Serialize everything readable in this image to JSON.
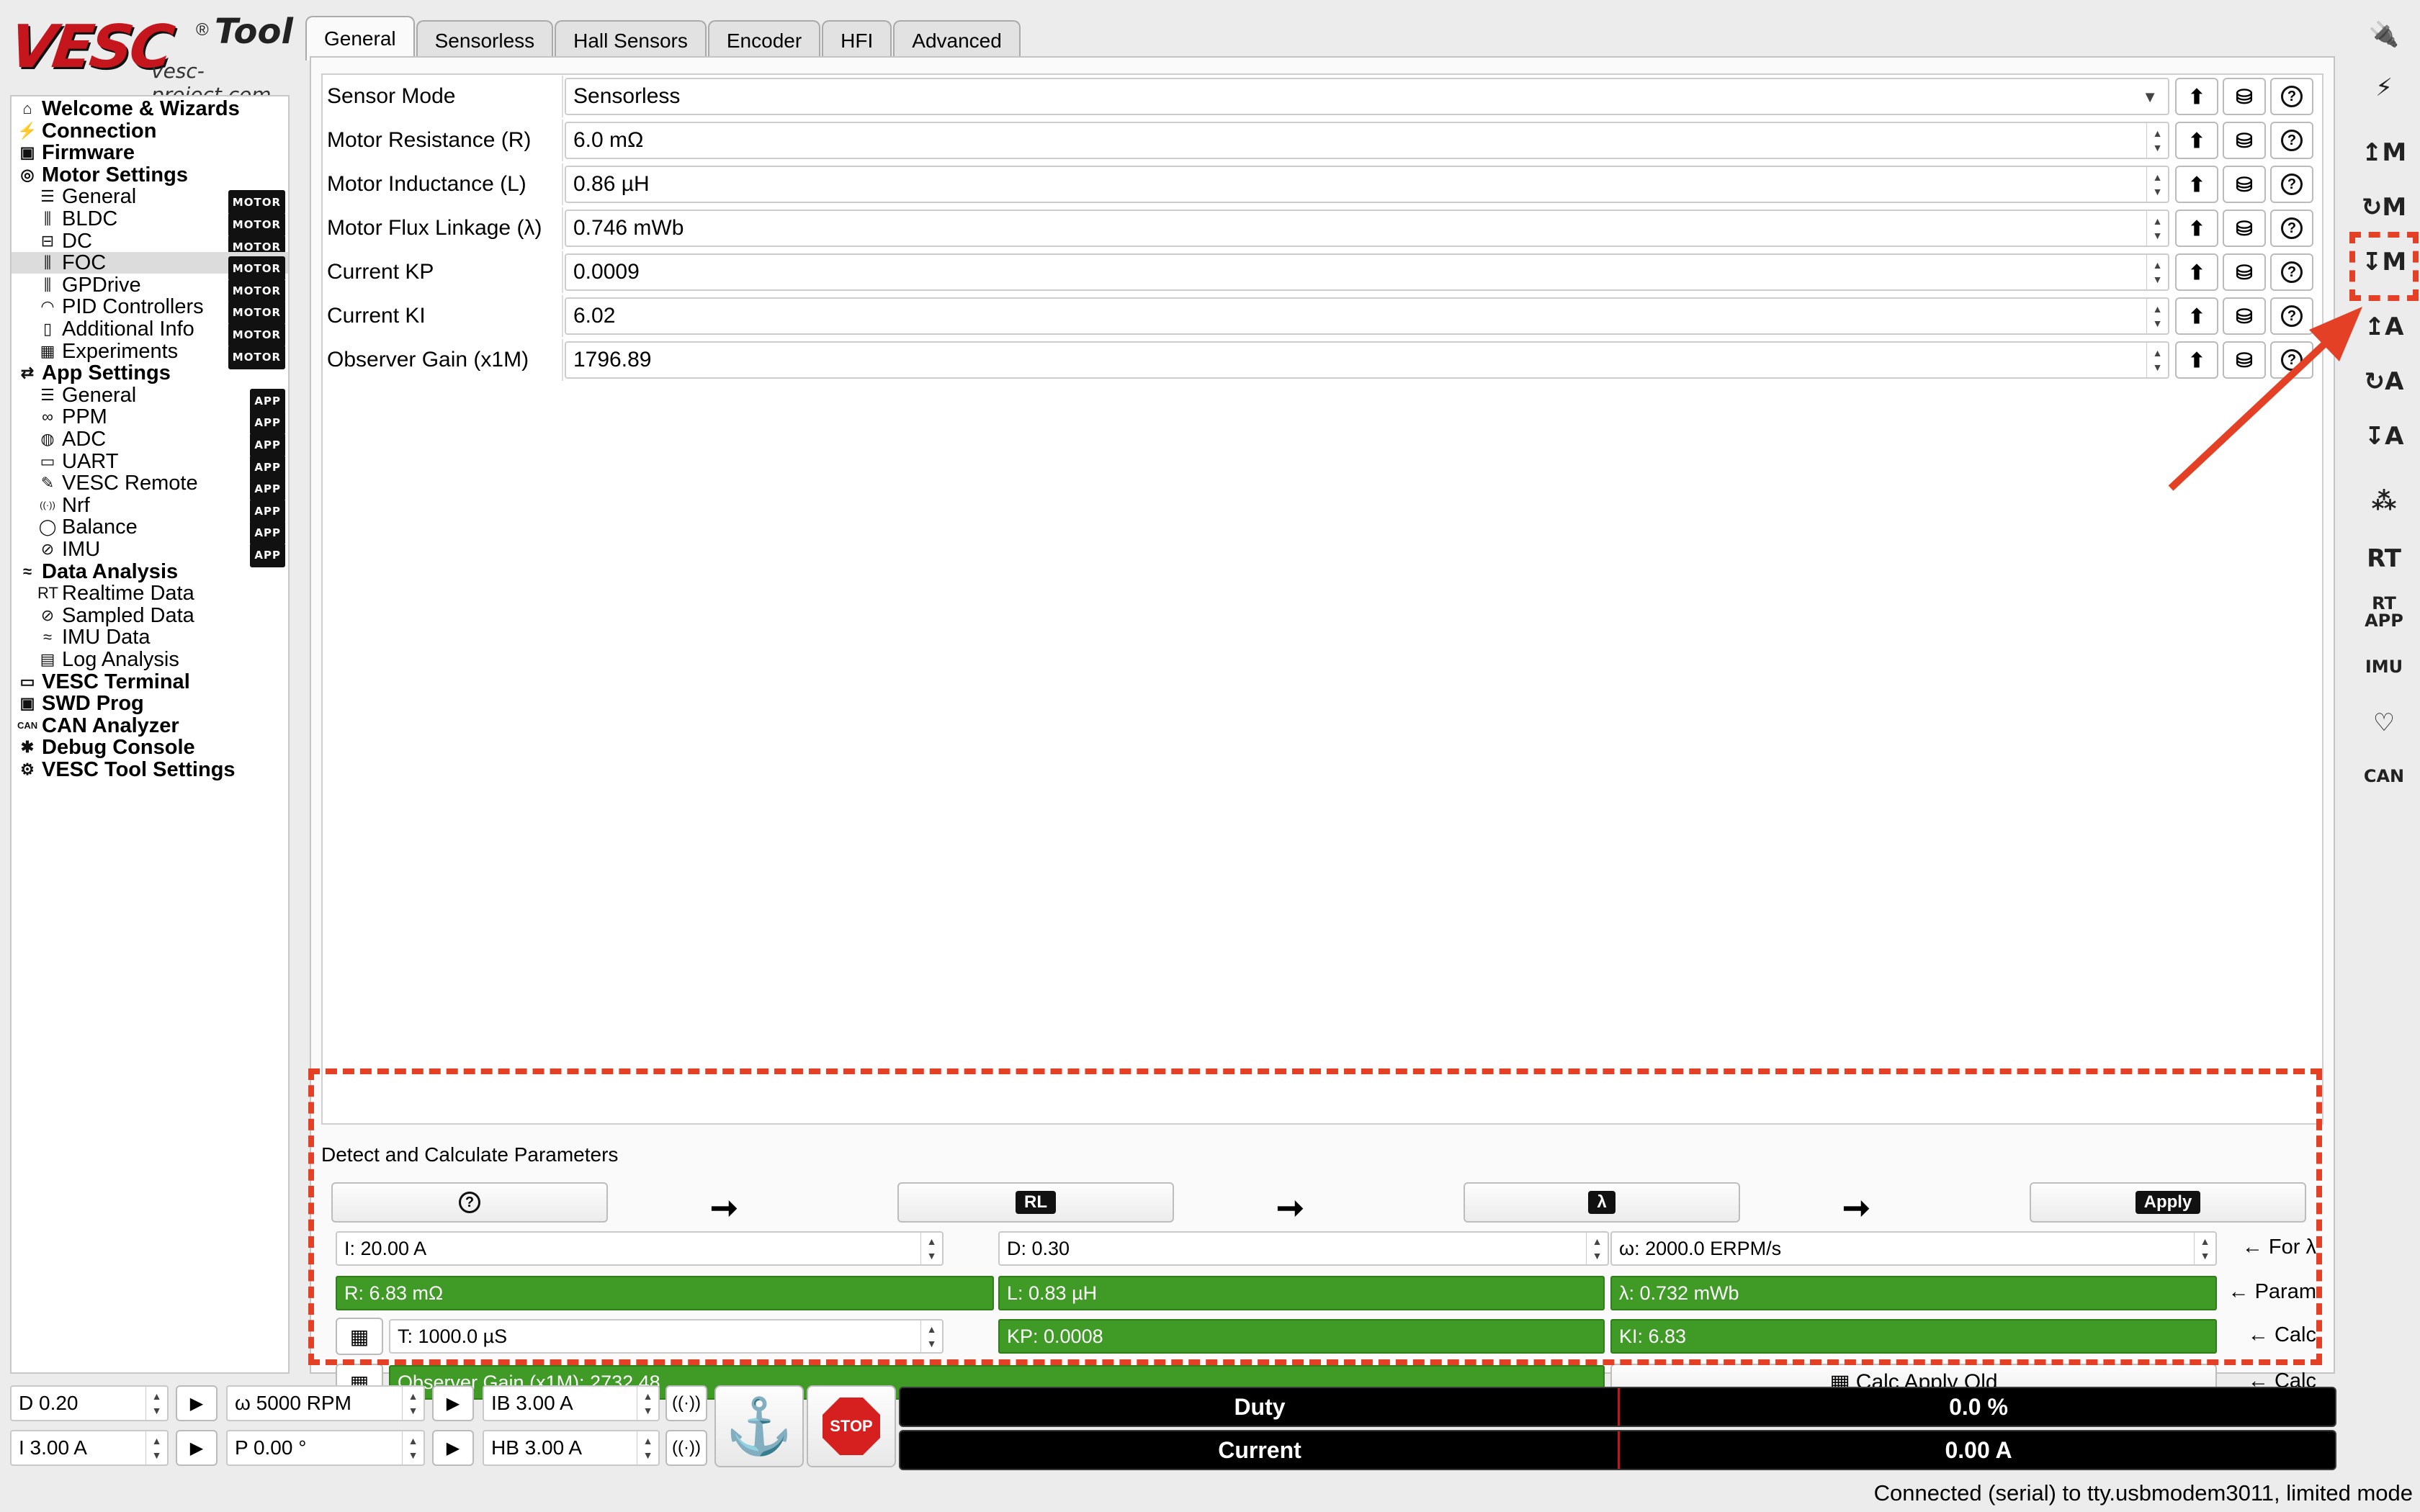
{
  "logo": {
    "brand": "VESC",
    "tool": "Tool",
    "reg": "®",
    "site": "vesc-project.com"
  },
  "tree": [
    {
      "label": "Welcome & Wizards",
      "icon": "⌂",
      "level": "top",
      "icon_name": "home-icon"
    },
    {
      "label": "Connection",
      "icon": "⚡",
      "level": "top",
      "icon_name": "plug-icon"
    },
    {
      "label": "Firmware",
      "icon": "▣",
      "level": "top",
      "icon_name": "chip-icon"
    },
    {
      "label": "Motor Settings",
      "icon": "◎",
      "level": "top",
      "icon_name": "motor-icon"
    },
    {
      "label": "General",
      "icon": "☰",
      "level": "sub",
      "badge": "MOTOR",
      "icon_name": "sliders-icon"
    },
    {
      "label": "BLDC",
      "icon": "⫼",
      "level": "sub",
      "badge": "MOTOR",
      "icon_name": "bldc-icon"
    },
    {
      "label": "DC",
      "icon": "⊟",
      "level": "sub",
      "badge": "MOTOR",
      "icon_name": "dc-icon"
    },
    {
      "label": "FOC",
      "icon": "⫼",
      "level": "sub",
      "badge": "MOTOR",
      "icon_name": "foc-icon",
      "selected": true
    },
    {
      "label": "GPDrive",
      "icon": "⫼",
      "level": "sub",
      "badge": "MOTOR",
      "icon_name": "gpdrive-icon"
    },
    {
      "label": "PID Controllers",
      "icon": "◠",
      "level": "sub",
      "badge": "MOTOR",
      "icon_name": "gauge-icon"
    },
    {
      "label": "Additional Info",
      "icon": "▯",
      "level": "sub",
      "badge": "MOTOR",
      "icon_name": "info-icon"
    },
    {
      "label": "Experiments",
      "icon": "▦",
      "level": "sub",
      "badge": "MOTOR",
      "icon_name": "calculator-icon"
    },
    {
      "label": "App Settings",
      "icon": "⇄",
      "level": "top",
      "icon_name": "app-settings-icon"
    },
    {
      "label": "General",
      "icon": "☰",
      "level": "sub",
      "badge": "APP",
      "icon_name": "sliders-icon"
    },
    {
      "label": "PPM",
      "icon": "∞",
      "level": "sub",
      "badge": "APP",
      "icon_name": "ppm-icon"
    },
    {
      "label": "ADC",
      "icon": "◍",
      "level": "sub",
      "badge": "APP",
      "icon_name": "adc-icon"
    },
    {
      "label": "UART",
      "icon": "▭",
      "level": "sub",
      "badge": "APP",
      "icon_name": "uart-icon"
    },
    {
      "label": "VESC Remote",
      "icon": "✎",
      "level": "sub",
      "badge": "APP",
      "icon_name": "remote-icon"
    },
    {
      "label": "Nrf",
      "icon": "((·))",
      "level": "sub",
      "badge": "APP",
      "icon_name": "wireless-icon"
    },
    {
      "label": "Balance",
      "icon": "◯",
      "level": "sub",
      "badge": "APP",
      "icon_name": "balance-icon"
    },
    {
      "label": "IMU",
      "icon": "⊘",
      "level": "sub",
      "badge": "APP",
      "icon_name": "imu-icon"
    },
    {
      "label": "Data Analysis",
      "icon": "≈",
      "level": "top",
      "icon_name": "data-analysis-icon"
    },
    {
      "label": "Realtime Data",
      "icon": "RT",
      "level": "sub",
      "icon_name": "realtime-icon"
    },
    {
      "label": "Sampled Data",
      "icon": "⊘",
      "level": "sub",
      "icon_name": "sampled-icon"
    },
    {
      "label": "IMU Data",
      "icon": "≈",
      "level": "sub",
      "icon_name": "imu-data-icon"
    },
    {
      "label": "Log Analysis",
      "icon": "▤",
      "level": "sub",
      "icon_name": "log-icon"
    },
    {
      "label": "VESC Terminal",
      "icon": "▭",
      "level": "top",
      "icon_name": "terminal-icon"
    },
    {
      "label": "SWD Prog",
      "icon": "▣",
      "level": "top",
      "icon_name": "swd-icon"
    },
    {
      "label": "CAN Analyzer",
      "icon": "CAN",
      "level": "top",
      "icon_name": "can-icon"
    },
    {
      "label": "Debug Console",
      "icon": "✱",
      "level": "top",
      "icon_name": "bug-icon"
    },
    {
      "label": "VESC Tool Settings",
      "icon": "⚙",
      "level": "top",
      "icon_name": "gear-icon"
    }
  ],
  "tabs": [
    "General",
    "Sensorless",
    "Hall Sensors",
    "Encoder",
    "HFI",
    "Advanced"
  ],
  "params": [
    {
      "label": "Sensor Mode",
      "value": "Sensorless",
      "kind": "combo"
    },
    {
      "label": "Motor Resistance (R)",
      "value": "6.0 mΩ",
      "kind": "spin"
    },
    {
      "label": "Motor Inductance (L)",
      "value": "0.86 µH",
      "kind": "spin"
    },
    {
      "label": "Motor Flux Linkage (λ)",
      "value": "0.746 mWb",
      "kind": "spin"
    },
    {
      "label": "Current KP",
      "value": "0.0009",
      "kind": "spin"
    },
    {
      "label": "Current KI",
      "value": "6.02",
      "kind": "spin"
    },
    {
      "label": "Observer Gain (x1M)",
      "value": "1796.89",
      "kind": "spin"
    }
  ],
  "detect": {
    "title": "Detect and Calculate Parameters",
    "help": "?",
    "rl": "RL",
    "lambda": "λ",
    "apply": "Apply",
    "arrow": "➞",
    "current": "I: 20.00 A",
    "duty": "D: 0.30",
    "erpm": "ω: 2000.0 ERPM/s",
    "for_lambda": "← For λ",
    "r": "R: 6.83 mΩ",
    "l": "L: 0.83 µH",
    "flux": "λ: 0.732 mWb",
    "param": "← Param",
    "tc": "T: 1000.0 µS",
    "kp": "KP: 0.0008",
    "ki": "KI: 6.83",
    "calc": "← Calc",
    "obs": "Observer Gain (x1M): 2732.48",
    "calc_apply_old": "Calc Apply Old",
    "calc2": "← Calc"
  },
  "rbar": [
    {
      "glyph": "🔌",
      "name": "connect-icon"
    },
    {
      "glyph": "⚡",
      "name": "disconnect-icon"
    },
    {
      "glyph": "↥M",
      "name": "write-motor-config-icon"
    },
    {
      "glyph": "↻M",
      "name": "reload-motor-config-icon"
    },
    {
      "glyph": "↧M",
      "name": "read-motor-config-icon"
    },
    {
      "glyph": "↥A",
      "name": "write-app-config-icon"
    },
    {
      "glyph": "↻A",
      "name": "reload-app-config-icon"
    },
    {
      "glyph": "↧A",
      "name": "read-app-config-icon"
    },
    {
      "glyph": "⁂",
      "name": "can-devices-icon"
    },
    {
      "glyph": "RT",
      "name": "realtime-data-icon"
    },
    {
      "glyph": "RT APP",
      "name": "realtime-app-icon"
    },
    {
      "glyph": "IMU",
      "name": "imu-stream-icon"
    },
    {
      "glyph": "♡",
      "name": "heartbeat-icon"
    },
    {
      "glyph": "CAN",
      "name": "can-forward-icon"
    }
  ],
  "bottom": {
    "duty": "D 0.20",
    "rpm": "ω 5000 RPM",
    "ib": "IB 3.00 A",
    "current": "I 3.00 A",
    "pos": "P 0.00 °",
    "hb": "HB 3.00 A",
    "play": "▶",
    "brake": "((·))",
    "anchor": "⚓",
    "stop": "STOP",
    "gauge_duty_label": "Duty",
    "gauge_duty_value": "0.0 %",
    "gauge_current_label": "Current",
    "gauge_current_value": "0.00 A"
  },
  "status": "Connected (serial) to tty.usbmodem3011, limited mode",
  "colors": {
    "accent_green": "#3f9a26",
    "annotation_red": "#e44026",
    "brand_red": "#c4161c"
  }
}
